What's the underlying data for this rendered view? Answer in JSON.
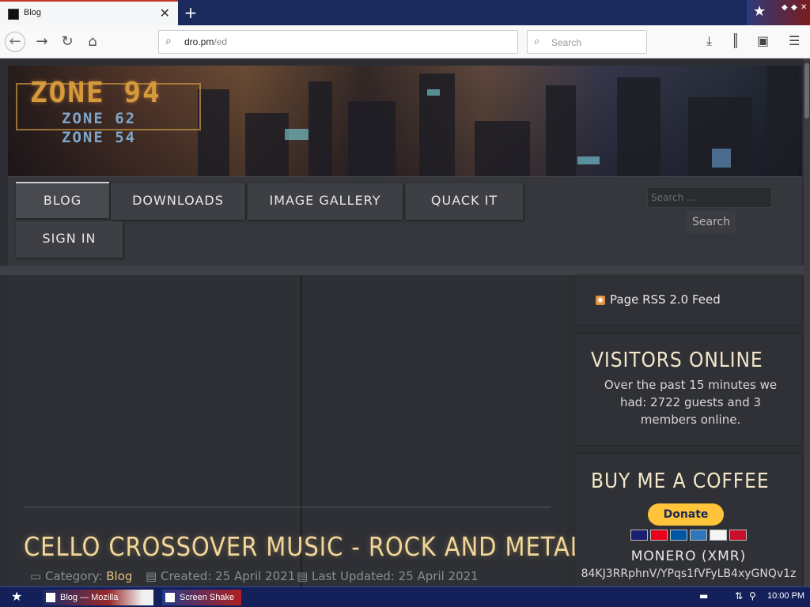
{
  "browser": {
    "tab_title": "Blog",
    "new_tab": "+",
    "url_host": "dro.pm",
    "url_path": "/ed",
    "search_placeholder": "Search"
  },
  "site": {
    "logo_main": "ZONE 94",
    "logo_sub1": "ZONE 62",
    "logo_sub2": "ZONE 54"
  },
  "menu": {
    "items": [
      "BLOG",
      "DOWNLOADS",
      "IMAGE GALLERY",
      "QUACK IT",
      "SIGN IN"
    ],
    "active": "BLOG",
    "search_placeholder": "Search ...",
    "search_button": "Search"
  },
  "article": {
    "title": "CELLO CROSSOVER MUSIC - ROCK AND METAL",
    "category_label": "Category:",
    "category": "Blog",
    "created": "Created: 25 April 2021",
    "updated": "Last Updated: 25 April 2021"
  },
  "sidebar": {
    "rss_text": "Page RSS 2.0 Feed",
    "visitors_title": "VISITORS ONLINE",
    "visitors_text": "Over the past 15 minutes we had: 2722 guests and 3 members online.",
    "coffee_title": "BUY ME A COFFEE",
    "donate_label": "Donate",
    "monero_label": "MONERO (XMR)",
    "monero_address": "84KJ3RRphnV/YPqs1fVFyLB4xyGNQv1z"
  },
  "taskbar": {
    "task1": "Blog — Mozilla",
    "task2": "Screen Shake",
    "clock": "10:00 PM"
  },
  "colors": {
    "accent_gold": "#f2d79a",
    "link_gold": "#e5c07b",
    "taskbar_blue": "#14205a"
  }
}
